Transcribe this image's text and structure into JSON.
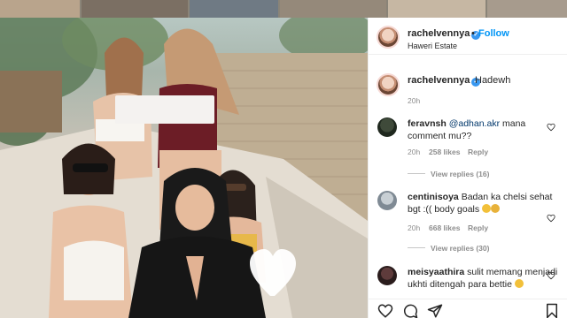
{
  "post": {
    "username": "rachelvennya",
    "follow_separator": "•",
    "follow_label": "Follow",
    "location": "Haweri Estate",
    "caption": "Hadewh",
    "caption_time": "20h"
  },
  "comments": [
    {
      "username": "feravnsh",
      "mention": "@adhan.akr",
      "text": " mana comment mu??",
      "time": "20h",
      "likes": "258 likes",
      "reply": "Reply",
      "view_replies": "View replies (16)"
    },
    {
      "username": "centinisoya",
      "text": " Badan ka chelsi sehat bgt :(( body goals",
      "time": "20h",
      "likes": "668 likes",
      "reply": "Reply",
      "view_replies": "View replies (30)"
    },
    {
      "username": "meisyaathira",
      "text": " sulit memang menjadi ukhti ditengah para bettie"
    }
  ],
  "colors": {
    "follow": "#0095f6",
    "verified": "#3897f0",
    "muted": "#8e8e8e",
    "mention": "#00376b"
  },
  "icons": [
    "verified-badge-icon",
    "heart-icon",
    "comment-icon",
    "share-icon",
    "bookmark-icon"
  ]
}
